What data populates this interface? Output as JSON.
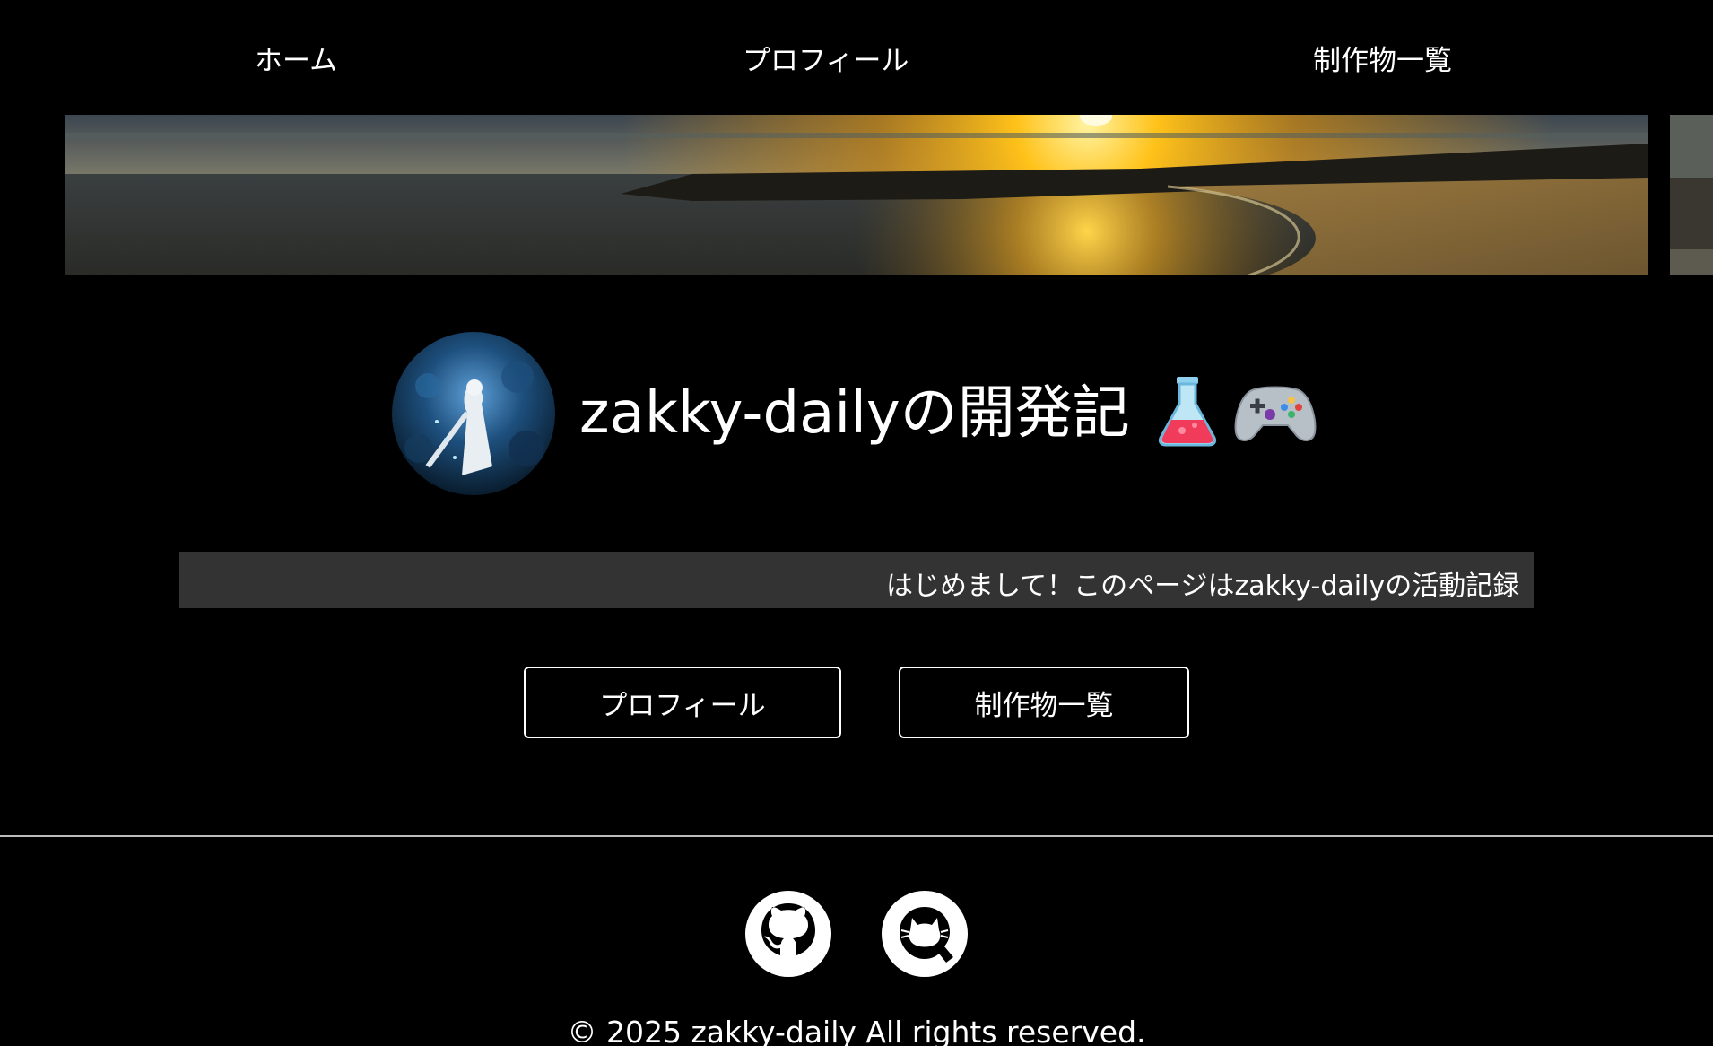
{
  "nav": {
    "items": [
      {
        "label": "ホーム"
      },
      {
        "label": "プロフィール"
      },
      {
        "label": "制作物一覧"
      }
    ]
  },
  "hero": {
    "title": "zakky-dailyの開発記",
    "title_icons": [
      "flask-icon",
      "gamepad-icon"
    ]
  },
  "marquee": {
    "text": "はじめまして！このページはzakky-dailyの活動記録"
  },
  "buttons": {
    "profile_label": "プロフィール",
    "works_label": "制作物一覧"
  },
  "footer": {
    "social_icons": [
      "github-icon",
      "qiita-icon"
    ],
    "copyright": "© 2025 zakky-daily All rights reserved."
  },
  "colors": {
    "background": "#000000",
    "marquee_bg": "#333333",
    "text": "#ffffff",
    "divider": "#bbbbbb"
  }
}
